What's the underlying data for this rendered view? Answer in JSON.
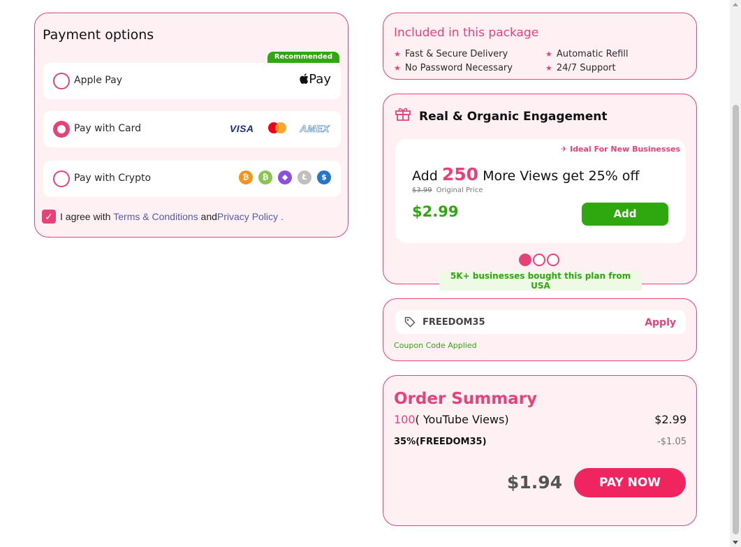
{
  "payment": {
    "title": "Payment options",
    "recommended_badge": "Recommended",
    "options": [
      {
        "label": "Apple Pay",
        "brand": "Pay",
        "selected": false
      },
      {
        "label": "Pay with Card",
        "selected": true,
        "brands": [
          "VISA",
          "AMEX"
        ]
      },
      {
        "label": "Pay with Crypto",
        "selected": false,
        "coins": [
          "₿",
          "₿",
          "◆",
          "Ł",
          "$"
        ]
      }
    ],
    "agree": {
      "prefix": "I agree with",
      "terms": "Terms & Conditions",
      "and": "and",
      "privacy": "Privacy Policy",
      "suffix": ".",
      "checked": true
    }
  },
  "included": {
    "title": "Included in this package",
    "features": [
      "Fast & Secure Delivery",
      "Automatic Refill",
      "No Password Necessary",
      "24/7 Support"
    ]
  },
  "engagement": {
    "title": "Real & Organic Engagement",
    "tag": "Ideal For New Businesses",
    "offer_prefix": "Add",
    "offer_amount": "250",
    "offer_suffix": "More Views get 25% off",
    "original_price": "$3.99",
    "original_label": "Original Price",
    "price": "$2.99",
    "add_label": "Add",
    "carousel_active_index": 0,
    "carousel_count": 3,
    "social_proof": "5K+ businesses bought this plan from USA"
  },
  "coupon": {
    "code": "FREEDOM35",
    "apply_label": "Apply",
    "status": "Coupon Code Applied"
  },
  "summary": {
    "title": "Order Summary",
    "quantity": "100",
    "item": "( YouTube Views)",
    "item_price": "$2.99",
    "discount_label": "35%(FREEDOM35)",
    "discount_value": "-$1.05",
    "total": "$1.94",
    "pay_label": "PAY NOW"
  },
  "colors": {
    "accent": "#e8417a",
    "pay_button": "#f0245e",
    "success": "#2ea80e",
    "card_bg": "#fff0f4"
  }
}
